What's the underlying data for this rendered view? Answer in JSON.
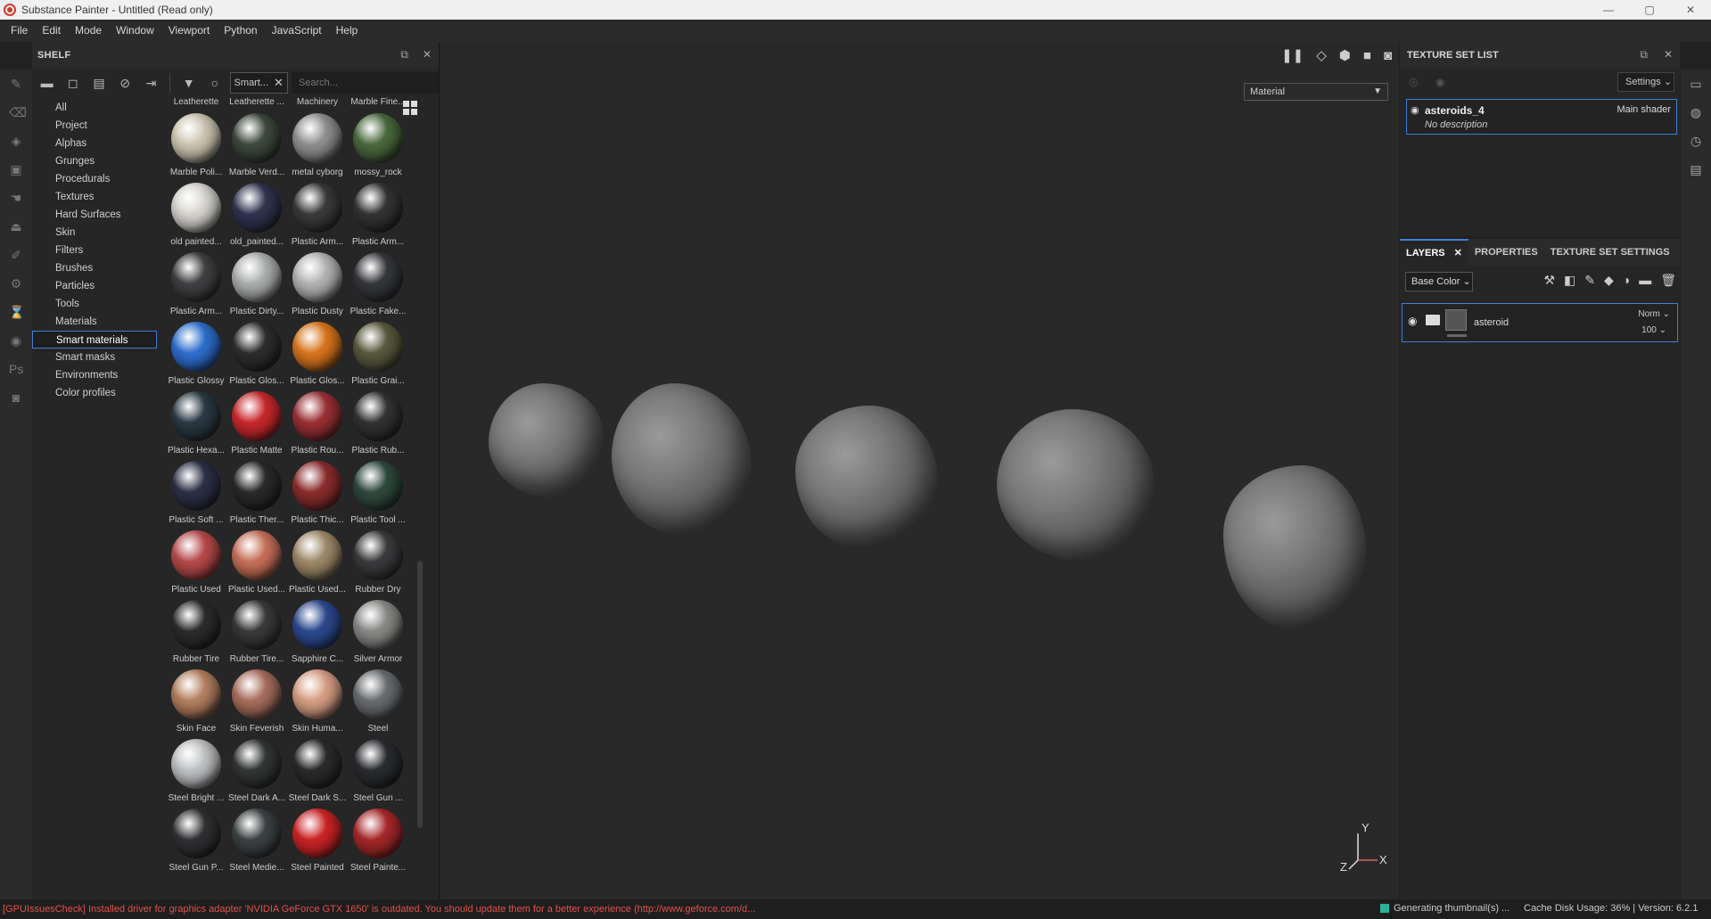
{
  "window": {
    "title": "Substance Painter - Untitled (Read only)",
    "controls": [
      "—",
      "▢",
      "✕"
    ]
  },
  "menu": [
    "File",
    "Edit",
    "Mode",
    "Window",
    "Viewport",
    "Python",
    "JavaScript",
    "Help"
  ],
  "shelf": {
    "title": "SHELF",
    "filter_chip": "Smart...",
    "search_placeholder": "Search...",
    "categories": [
      "All",
      "Project",
      "Alphas",
      "Grunges",
      "Procedurals",
      "Textures",
      "Hard Surfaces",
      "Skin",
      "Filters",
      "Brushes",
      "Particles",
      "Tools",
      "Materials",
      "Smart materials",
      "Smart masks",
      "Environments",
      "Color profiles"
    ],
    "selected_category": "Smart materials",
    "top_labels": [
      "Leatherette",
      "Leatherette ...",
      "Machinery",
      "Marble Fine..."
    ],
    "items": [
      {
        "label": "Marble Poli...",
        "color": "#cfc7b2"
      },
      {
        "label": "Marble Verd...",
        "color": "#3d4a3d"
      },
      {
        "label": "metal cyborg",
        "color": "#8f9090"
      },
      {
        "label": "mossy_rock",
        "color": "#4a6a3e"
      },
      {
        "label": "old painted...",
        "color": "#d8d6d0"
      },
      {
        "label": "old_painted...",
        "color": "#2f3550"
      },
      {
        "label": "Plastic Arm...",
        "color": "#3a3a3c"
      },
      {
        "label": "Plastic Arm...",
        "color": "#343436"
      },
      {
        "label": "Plastic Arm...",
        "color": "#3f4042"
      },
      {
        "label": "Plastic Dirty...",
        "color": "#aeb0b0"
      },
      {
        "label": "Plastic Dusty",
        "color": "#b4b5b5"
      },
      {
        "label": "Plastic Fake...",
        "color": "#35373b"
      },
      {
        "label": "Plastic Glossy",
        "color": "#2e6fd0"
      },
      {
        "label": "Plastic Glos...",
        "color": "#2d2e2e"
      },
      {
        "label": "Plastic Glos...",
        "color": "#d9761e"
      },
      {
        "label": "Plastic Grai...",
        "color": "#5a5a3e"
      },
      {
        "label": "Plastic Hexa...",
        "color": "#2a3a44"
      },
      {
        "label": "Plastic Matte",
        "color": "#c8282c"
      },
      {
        "label": "Plastic Rou...",
        "color": "#9a3035"
      },
      {
        "label": "Plastic Rub...",
        "color": "#333335"
      },
      {
        "label": "Plastic Soft ...",
        "color": "#2c3048"
      },
      {
        "label": "Plastic Ther...",
        "color": "#2a2a2a"
      },
      {
        "label": "Plastic Thic...",
        "color": "#8c2d2e"
      },
      {
        "label": "Plastic Tool ...",
        "color": "#2f4a3e"
      },
      {
        "label": "Plastic Used",
        "color": "#b84a4a"
      },
      {
        "label": "Plastic Used...",
        "color": "#c8705a"
      },
      {
        "label": "Plastic Used...",
        "color": "#a08a6a"
      },
      {
        "label": "Rubber Dry",
        "color": "#3a3b3d"
      },
      {
        "label": "Rubber Tire",
        "color": "#2c2c2c"
      },
      {
        "label": "Rubber Tire...",
        "color": "#3a3a3a"
      },
      {
        "label": "Sapphire C...",
        "color": "#2d4a90"
      },
      {
        "label": "Silver Armor",
        "color": "#8a8a88"
      },
      {
        "label": "Skin Face",
        "color": "#b58060"
      },
      {
        "label": "Skin Feverish",
        "color": "#a86e5e"
      },
      {
        "label": "Skin Huma...",
        "color": "#d9a085"
      },
      {
        "label": "Steel",
        "color": "#6a6d70"
      },
      {
        "label": "Steel Bright ...",
        "color": "#c0c2c4"
      },
      {
        "label": "Steel Dark A...",
        "color": "#333536"
      },
      {
        "label": "Steel Dark S...",
        "color": "#2a2b2c"
      },
      {
        "label": "Steel Gun ...",
        "color": "#2a2c30"
      },
      {
        "label": "Steel Gun P...",
        "color": "#303133"
      },
      {
        "label": "Steel Medie...",
        "color": "#3c4244"
      },
      {
        "label": "Steel Painted",
        "color": "#cc2426"
      },
      {
        "label": "Steel Painte...",
        "color": "#a8282a"
      }
    ]
  },
  "viewport": {
    "mode": "Material",
    "axes": [
      "Y",
      "Z",
      "X"
    ]
  },
  "texture_set_list": {
    "title": "TEXTURE SET LIST",
    "settings_label": "Settings",
    "set_name": "asteroids_4",
    "shader": "Main shader",
    "description": "No description"
  },
  "layers": {
    "tabs": [
      "LAYERS",
      "PROPERTIES",
      "TEXTURE SET SETTINGS"
    ],
    "channel": "Base Color",
    "layer_name": "asteroid",
    "blend_mode": "Norm",
    "opacity": "100"
  },
  "status": {
    "error": "[GPUIssuesCheck] Installed driver for graphics adapter 'NVIDIA GeForce GTX 1650' is outdated. You should update them for a better experience (http://www.geforce.com/d...",
    "generating": "Generating thumbnail(s) ...",
    "cache": "Cache Disk Usage:    36% | Version: 6.2.1"
  },
  "colors": {
    "accent": "#3d7fd6",
    "error": "#e0524a",
    "status_dot": "#2bb39a"
  }
}
